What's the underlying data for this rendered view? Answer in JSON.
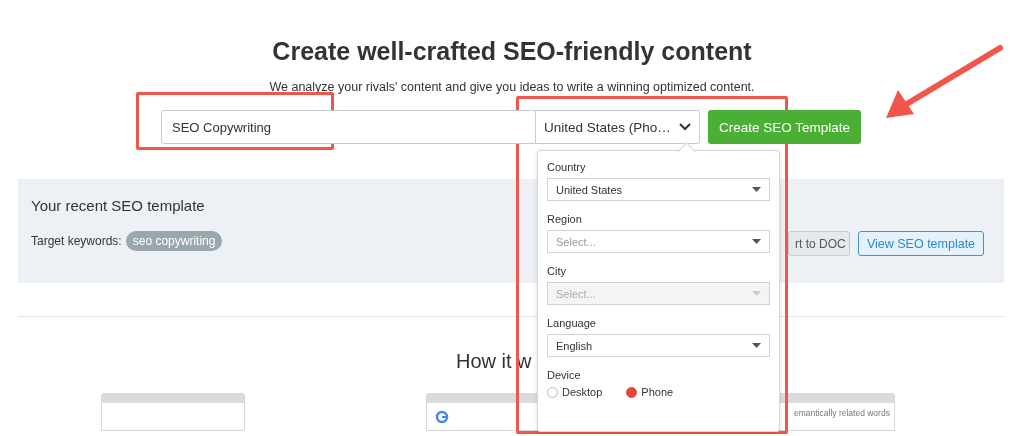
{
  "header": {
    "title": "Create well-crafted SEO-friendly content",
    "subtitle": "We analyze your rivals' content and give you ideas to write a winning optimized content."
  },
  "search": {
    "keyword": "SEO Copywriting",
    "location": "United States (Pho…",
    "button": "Create SEO Template"
  },
  "recent": {
    "title": "Your recent SEO template",
    "keywords_label": "Target keywords:",
    "keywords": [
      "seo copywriting"
    ],
    "buttons": [
      {
        "label": "rt to DOC",
        "kind": "secondary"
      },
      {
        "label": "View SEO template",
        "kind": "primary"
      }
    ]
  },
  "how_it_works": {
    "title": "How it w",
    "cards": [
      {
        "kind": "blank"
      },
      {
        "kind": "search"
      },
      {
        "kind": "list",
        "text": "emantically related words"
      }
    ]
  },
  "location_popup": {
    "fields": [
      {
        "label": "Country",
        "value": "United States",
        "disabled": false
      },
      {
        "label": "Region",
        "placeholder": "Select...",
        "disabled": false
      },
      {
        "label": "City",
        "placeholder": "Select...",
        "disabled": true
      },
      {
        "label": "Language",
        "value": "English",
        "disabled": false
      }
    ],
    "device": {
      "label": "Device",
      "options": [
        {
          "label": "Desktop",
          "selected": false
        },
        {
          "label": "Phone",
          "selected": true
        }
      ]
    }
  }
}
